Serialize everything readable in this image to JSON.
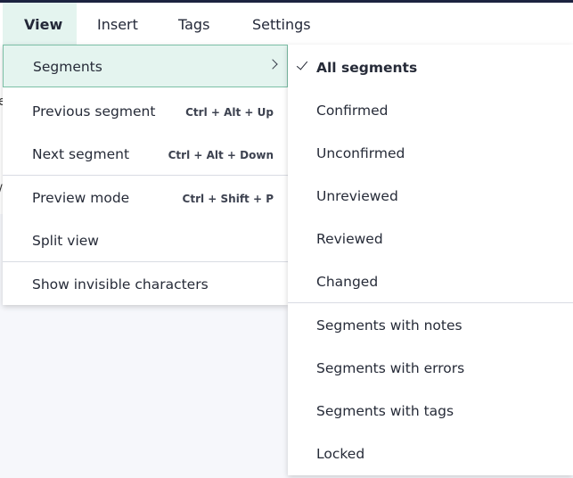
{
  "menubar": {
    "tabs": [
      {
        "label": "View"
      },
      {
        "label": "Insert"
      },
      {
        "label": "Tags"
      },
      {
        "label": "Settings"
      }
    ]
  },
  "view_menu": {
    "items": [
      {
        "label": "Segments",
        "shortcut": ""
      },
      {
        "label": "Previous segment",
        "shortcut": "Ctrl + Alt + Up"
      },
      {
        "label": "Next segment",
        "shortcut": "Ctrl + Alt + Down"
      },
      {
        "label": "Preview mode",
        "shortcut": "Ctrl + Shift + P"
      },
      {
        "label": "Split view",
        "shortcut": ""
      },
      {
        "label": "Show invisible characters",
        "shortcut": ""
      }
    ]
  },
  "segments_submenu": {
    "items": [
      {
        "label": "All segments",
        "checked": true
      },
      {
        "label": "Confirmed"
      },
      {
        "label": "Unconfirmed"
      },
      {
        "label": "Unreviewed"
      },
      {
        "label": "Reviewed"
      },
      {
        "label": "Changed"
      },
      {
        "label": "Segments with notes"
      },
      {
        "label": "Segments with errors"
      },
      {
        "label": "Segments with tags"
      },
      {
        "label": "Locked"
      }
    ]
  },
  "background": {
    "edge_glyph_1": "e",
    "edge_glyph_2": "/"
  }
}
